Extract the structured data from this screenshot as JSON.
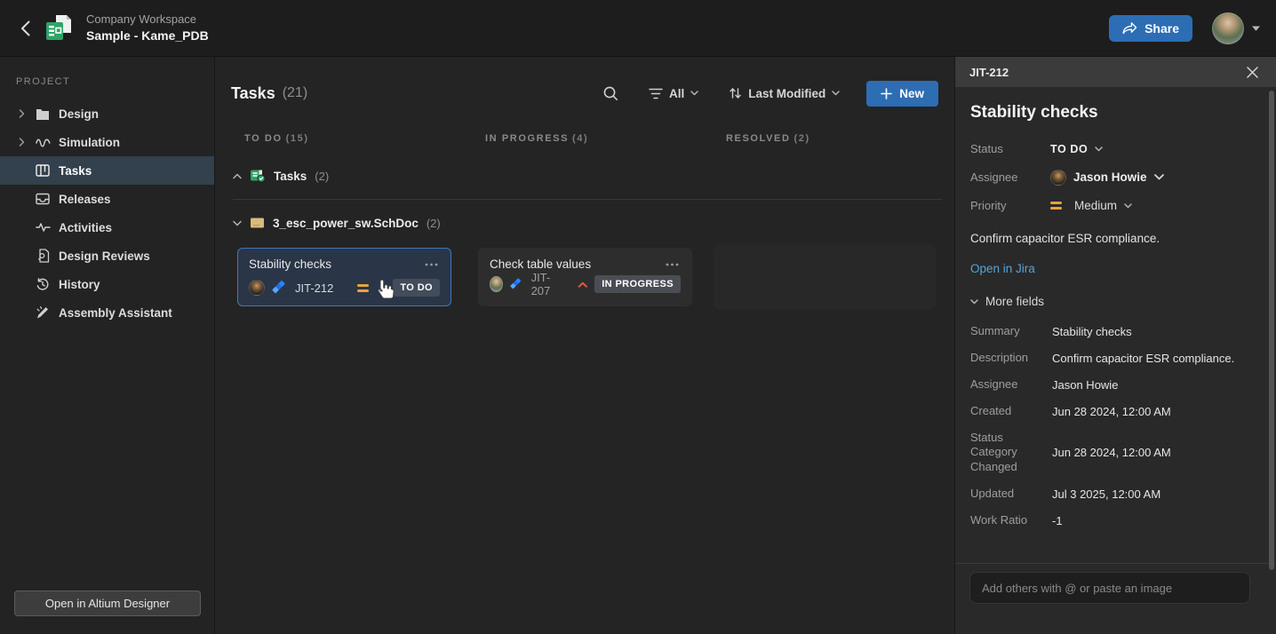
{
  "topbar": {
    "workspace_label": "Company Workspace",
    "project_name": "Sample - Kame_PDB",
    "share_label": "Share"
  },
  "sidebar": {
    "section_label": "PROJECT",
    "items": [
      {
        "label": "Design",
        "icon": "folder",
        "expandable": true
      },
      {
        "label": "Simulation",
        "icon": "waveform",
        "expandable": true
      },
      {
        "label": "Tasks",
        "icon": "kanban-board",
        "selected": true
      },
      {
        "label": "Releases",
        "icon": "inbox"
      },
      {
        "label": "Activities",
        "icon": "pulse"
      },
      {
        "label": "Design Reviews",
        "icon": "document-search"
      },
      {
        "label": "History",
        "icon": "history-clock"
      },
      {
        "label": "Assembly Assistant",
        "icon": "soldering-iron"
      }
    ],
    "open_in_designer_label": "Open in Altium Designer"
  },
  "toolbar": {
    "title": "Tasks",
    "count": "(21)",
    "filter_label": "All",
    "sort_label": "Last Modified",
    "new_label": "New"
  },
  "board": {
    "columns": [
      {
        "label": "TO DO",
        "count": "(15)"
      },
      {
        "label": "IN PROGRESS",
        "count": "(4)"
      },
      {
        "label": "RESOLVED",
        "count": "(2)"
      }
    ],
    "groups": [
      {
        "label": "Tasks",
        "count": "(2)",
        "icon": "tasks-doc-green"
      },
      {
        "label": "3_esc_power_sw.SchDoc",
        "count": "(2)",
        "icon": "schdoc-tan"
      }
    ],
    "cards": [
      {
        "title": "Stability checks",
        "key": "JIT-212",
        "priority": "medium",
        "status": "TO DO",
        "selected": true
      },
      {
        "title": "Check table values",
        "key": "JIT-207",
        "priority": "high",
        "status": "IN PROGRESS",
        "selected": false
      }
    ]
  },
  "panel": {
    "key": "JIT-212",
    "title": "Stability checks",
    "status_label": "Status",
    "status_value": "TO DO",
    "assignee_label": "Assignee",
    "assignee_value": "Jason Howie",
    "priority_label": "Priority",
    "priority_value": "Medium",
    "description": "Confirm capacitor ESR compliance.",
    "link_label": "Open in Jira",
    "more_fields_label": "More fields",
    "fields": [
      {
        "label": "Summary",
        "value": "Stability checks"
      },
      {
        "label": "Description",
        "value": "Confirm capacitor ESR compliance."
      },
      {
        "label": "Assignee",
        "value": "Jason Howie"
      },
      {
        "label": "Created",
        "value": "Jun 28 2024, 12:00 AM"
      },
      {
        "label": "Status Category Changed",
        "value": "Jun 28 2024, 12:00 AM"
      },
      {
        "label": "Updated",
        "value": "Jul 3 2025, 12:00 AM"
      },
      {
        "label": "Work Ratio",
        "value": "-1"
      }
    ],
    "comment_placeholder": "Add others with @ or paste an image"
  },
  "colors": {
    "accent_blue": "#2d6db4",
    "selected_card_border": "#3e78bd",
    "selected_card_bg": "#2a3547",
    "selected_sidebar_bg": "#33404d",
    "link_blue": "#56a5d6",
    "priority_medium_orange": "#e8a33d",
    "priority_high_red": "#e25641",
    "jira_blue": "#2684ff",
    "badge_bg": "#434c5b",
    "green_icon": "#2fa466",
    "schdoc_tan": "#d8bb7e",
    "panel_bg": "#292929",
    "topbar_bg": "#1d1d1d"
  }
}
